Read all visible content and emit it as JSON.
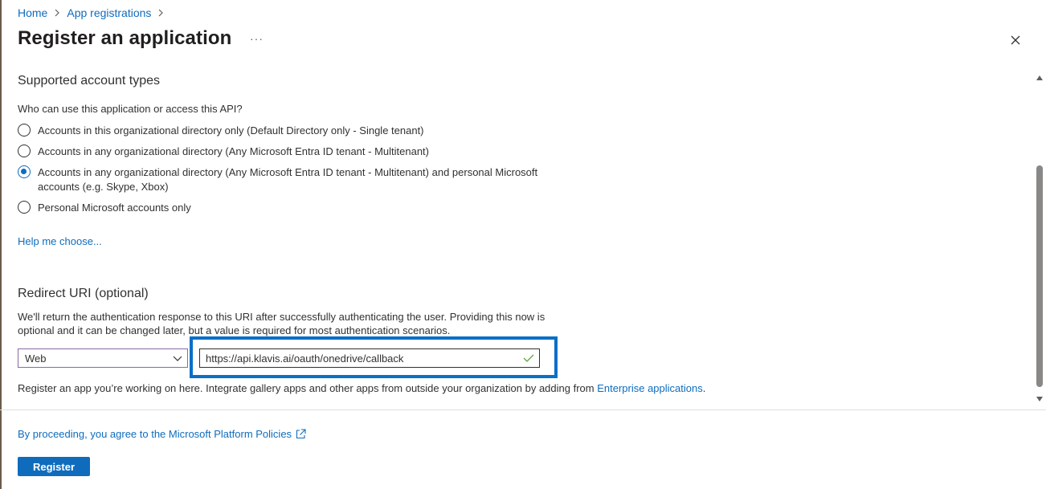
{
  "breadcrumb": {
    "home": "Home",
    "app_registrations": "App registrations",
    "sep_icon": "chevron-right-icon"
  },
  "header": {
    "title": "Register an application",
    "more": "···"
  },
  "supported_accounts": {
    "title": "Supported account types",
    "question": "Who can use this application or access this API?",
    "options": [
      {
        "label": "Accounts in this organizational directory only (Default Directory only - Single tenant)",
        "checked": false
      },
      {
        "label": "Accounts in any organizational directory (Any Microsoft Entra ID tenant - Multitenant)",
        "checked": false
      },
      {
        "label": "Accounts in any organizational directory (Any Microsoft Entra ID tenant - Multitenant) and personal Microsoft accounts (e.g. Skype, Xbox)",
        "checked": true
      },
      {
        "label": "Personal Microsoft accounts only",
        "checked": false
      }
    ],
    "help_link": "Help me choose..."
  },
  "redirect": {
    "title": "Redirect URI (optional)",
    "description": "We'll return the authentication response to this URI after successfully authenticating the user. Providing this now is optional and it can be changed later, but a value is required for most authentication scenarios.",
    "platform_value": "Web",
    "uri_value": "https://api.klavis.ai/oauth/onedrive/callback",
    "note_prefix": "Register an app you’re working on here. Integrate gallery apps and other apps from outside your organization by adding from ",
    "note_link": "Enterprise applications",
    "note_suffix": "."
  },
  "footer": {
    "policy_link": "By proceeding, you agree to the Microsoft Platform Policies",
    "register_label": "Register"
  },
  "colors": {
    "accent": "#0f6cbd",
    "highlight": "#0a6fc7"
  }
}
